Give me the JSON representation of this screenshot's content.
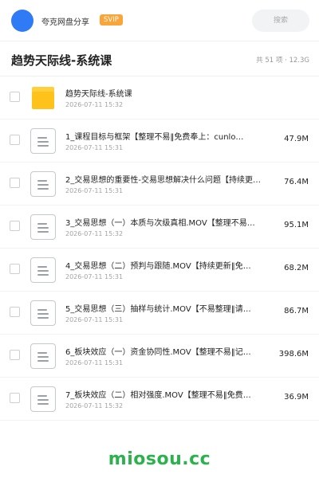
{
  "topbar": {
    "share_name": "夸克网盘分享",
    "badge": "SVIP",
    "search_placeholder": "搜索"
  },
  "header": {
    "title": "趋势天际线-系统课",
    "meta": "共 51 项 · 12.3G"
  },
  "files": [
    {
      "type": "folder",
      "name": "趋势天际线-系统课",
      "date": "2026-07-11 15:32",
      "size": ""
    },
    {
      "type": "file",
      "name": "1_课程目标与框架【整理不易‖免费奉上：cunlo…",
      "date": "2026-07-11 15:31",
      "size": "47.9M"
    },
    {
      "type": "file",
      "name": "2_交易思想的重要性-交易思想解决什么问题【持续更…",
      "date": "2026-07-11 15:31",
      "size": "76.4M"
    },
    {
      "type": "file",
      "name": "3_交易思想（一）本质与次级真相.MOV【整理不易…",
      "date": "2026-07-11 15:32",
      "size": "95.1M"
    },
    {
      "type": "file",
      "name": "4_交易思想（二）预判与跟随.MOV【持续更新‖免…",
      "date": "2026-07-11 15:31",
      "size": "68.2M"
    },
    {
      "type": "file",
      "name": "5_交易思想（三）抽样与统计.MOV【不易整理‖请…",
      "date": "2026-07-11 15:31",
      "size": "86.7M"
    },
    {
      "type": "file",
      "name": "6_板块效应（一）资金协同性.MOV【整理不易‖记…",
      "date": "2026-07-11 15:31",
      "size": "398.6M"
    },
    {
      "type": "file",
      "name": "7_板块效应（二）相对强度.MOV【整理不易‖免费…",
      "date": "2026-07-11 15:32",
      "size": "36.9M"
    }
  ],
  "watermark": "miosou.cc"
}
